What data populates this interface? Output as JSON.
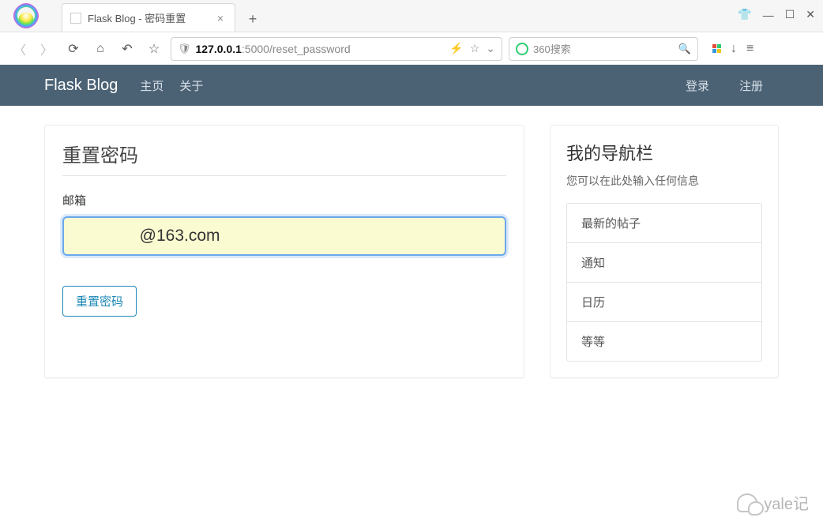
{
  "browser": {
    "tab_title": "Flask Blog - 密码重置",
    "url_host": "127.0.0.1",
    "url_port": ":5000",
    "url_path": "/reset_password",
    "search_placeholder": "360搜索"
  },
  "nav": {
    "brand": "Flask Blog",
    "home": "主页",
    "about": "关于",
    "login": "登录",
    "register": "注册"
  },
  "form": {
    "title": "重置密码",
    "email_label": "邮箱",
    "email_value": "              @163.com",
    "submit": "重置密码"
  },
  "sidebar": {
    "title": "我的导航栏",
    "desc": "您可以在此处输入任何信息",
    "items": [
      "最新的帖子",
      "通知",
      "日历",
      "等等"
    ]
  },
  "watermark": "yale记"
}
